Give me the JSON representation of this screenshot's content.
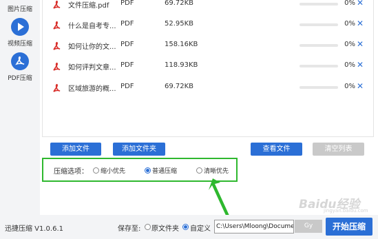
{
  "sidebar": {
    "items": [
      {
        "label": "图片压缩",
        "icon": "image-icon"
      },
      {
        "label": "视频压缩",
        "icon": "play-icon"
      },
      {
        "label": "PDF压缩",
        "icon": "pdf-icon"
      }
    ]
  },
  "files": [
    {
      "name": "文件压缩.pdf",
      "type": "PDF",
      "size": "69.72KB",
      "progress": "0%"
    },
    {
      "name": "什么是自考专...",
      "type": "PDF",
      "size": "52.95KB",
      "progress": "0%"
    },
    {
      "name": "如何让你的文...",
      "type": "PDF",
      "size": "158.16KB",
      "progress": "0%"
    },
    {
      "name": "如何评判文章...",
      "type": "PDF",
      "size": "118.93KB",
      "progress": "0%"
    },
    {
      "name": "区域旅游的概...",
      "type": "PDF",
      "size": "69.72KB",
      "progress": "0%"
    }
  ],
  "buttons": {
    "add_file": "添加文件",
    "add_folder": "添加文件夹",
    "view_files": "查看文件",
    "clear_list": "清空列表"
  },
  "options": {
    "label": "压缩选项：",
    "choices": [
      "缩小优先",
      "普通压缩",
      "清晰优先"
    ],
    "selected": "普通压缩"
  },
  "bottom": {
    "version": "迅捷压缩 V1.0.6.1",
    "save_to": "保存至:",
    "original_folder": "原文件夹",
    "custom": "自定义",
    "path": "C:\\Users\\Mloong\\Docume",
    "browse_fragment": "Gy",
    "start_button": "开始压缩"
  },
  "watermark": {
    "text": "Baidu经验",
    "url": "jingyan.baidu.com"
  },
  "colors": {
    "accent": "#2b6fd6",
    "highlight": "#2eb82e",
    "pdf_red": "#d9302c"
  }
}
